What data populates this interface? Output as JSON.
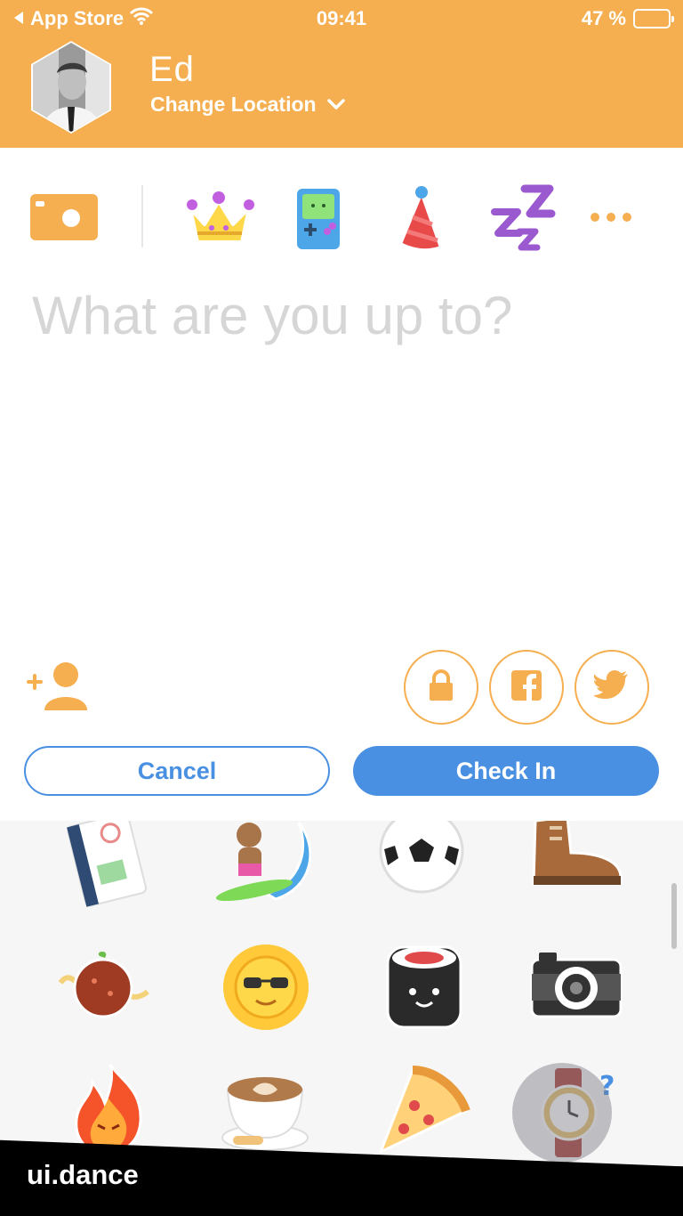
{
  "status_bar": {
    "back_label": "App Store",
    "time": "09:41",
    "battery_text": "47 %",
    "battery_level": 0.47
  },
  "profile": {
    "name": "Ed",
    "change_location_label": "Change Location"
  },
  "compose": {
    "placeholder": "What are you up to?"
  },
  "actions": {
    "cancel_label": "Cancel",
    "checkin_label": "Check In"
  },
  "stickers_top": [
    "crown",
    "gameboy",
    "party-hat",
    "zzz"
  ],
  "sticker_grid": [
    "passport",
    "surfing-bear",
    "soccer-ball",
    "boot",
    "meatball-spaghetti",
    "sunglasses-sun",
    "sushi-roll",
    "camera",
    "fire",
    "latte",
    "pizza-slice",
    "watch-question"
  ],
  "watermark": "ui.dance",
  "colors": {
    "brand_orange": "#F5AF50",
    "primary_blue": "#4A90E2"
  }
}
